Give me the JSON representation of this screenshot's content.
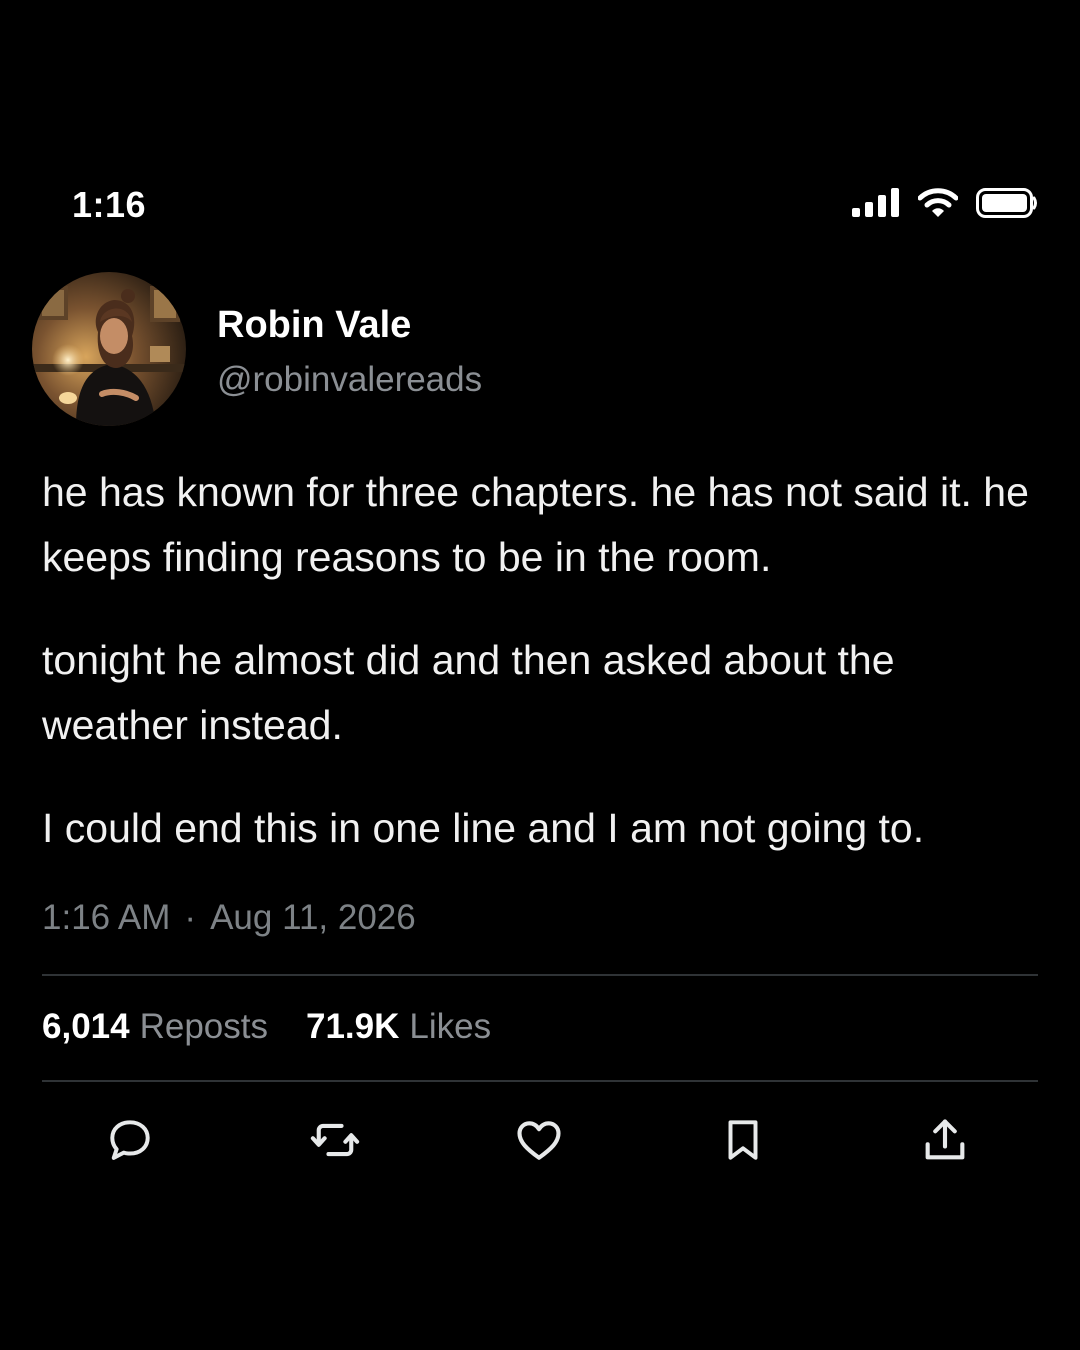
{
  "status_bar": {
    "time": "1:16",
    "icons": [
      "cellular-signal-icon",
      "wifi-icon",
      "battery-icon"
    ]
  },
  "author": {
    "display_name": "Robin Vale",
    "handle": "@robinvalereads",
    "avatar_icon": "profile-photo"
  },
  "post": {
    "paragraphs": [
      "he has known for three chapters. he has not said it. he keeps finding reasons to be in the room.",
      "tonight he almost did and then asked about the weather instead.",
      "I could end this in one line and I am not going to."
    ],
    "time": "1:16 AM",
    "separator": "·",
    "date": "Aug 11, 2026"
  },
  "stats": {
    "reposts_count": "6,014",
    "reposts_label": "Reposts",
    "likes_count": "71.9K",
    "likes_label": "Likes"
  },
  "actions": [
    "reply-icon",
    "repost-icon",
    "like-icon",
    "bookmark-icon",
    "share-icon"
  ],
  "colors": {
    "background": "#000000",
    "primary_text": "#ffffff",
    "secondary_text": "#8b8f94",
    "divider": "#2f3336"
  }
}
